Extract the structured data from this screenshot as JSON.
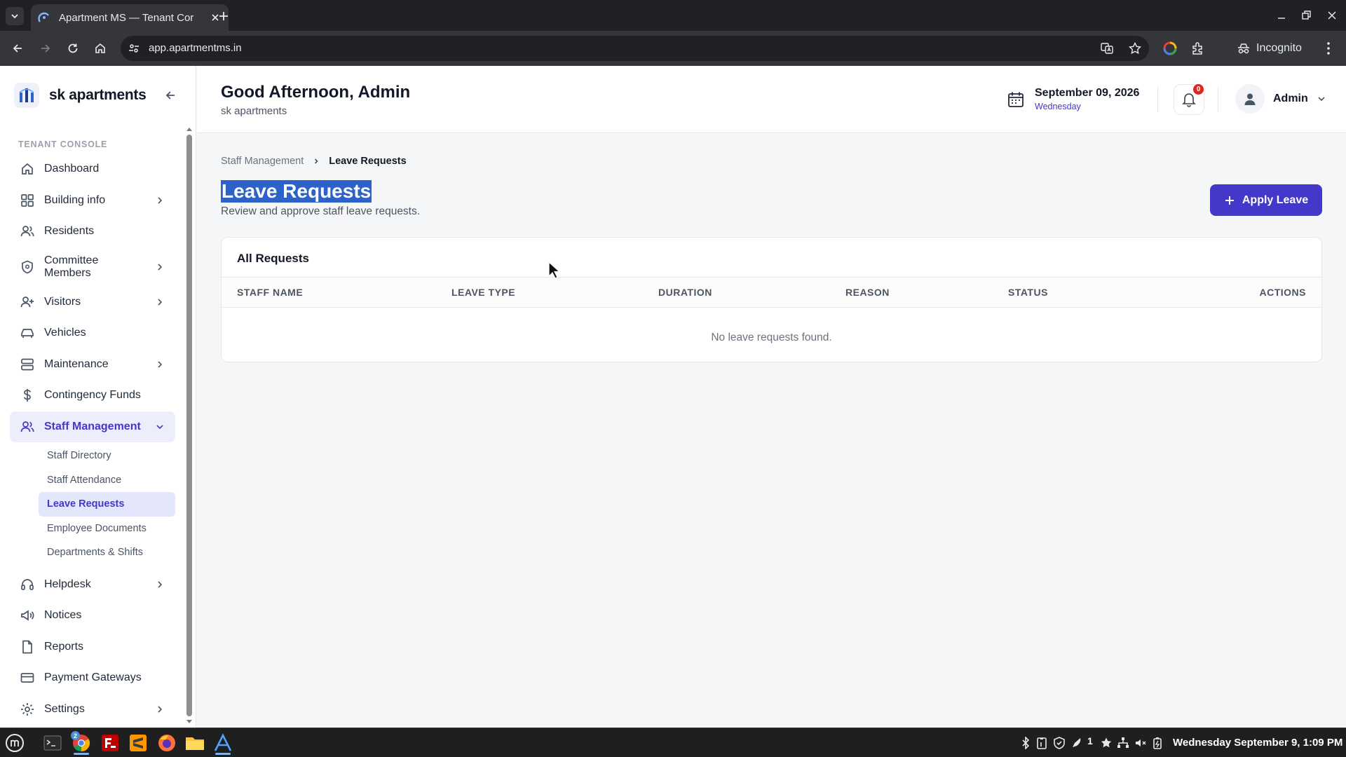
{
  "browser": {
    "tab_title": "Apartment MS — Tenant Cor",
    "url": "app.apartmentms.in",
    "profile_label": "Incognito"
  },
  "sidebar": {
    "brand_name": "sk apartments",
    "section_label": "TENANT CONSOLE",
    "items": [
      {
        "label": "Dashboard"
      },
      {
        "label": "Building info"
      },
      {
        "label": "Residents"
      },
      {
        "label": "Committee Members"
      },
      {
        "label": "Visitors"
      },
      {
        "label": "Vehicles"
      },
      {
        "label": "Maintenance"
      },
      {
        "label": "Contingency Funds"
      },
      {
        "label": "Staff Management"
      },
      {
        "label": "Helpdesk"
      },
      {
        "label": "Notices"
      },
      {
        "label": "Reports"
      },
      {
        "label": "Payment Gateways"
      },
      {
        "label": "Settings"
      }
    ],
    "staff_sub_items": [
      {
        "label": "Staff Directory"
      },
      {
        "label": "Staff Attendance"
      },
      {
        "label": "Leave Requests"
      },
      {
        "label": "Employee Documents"
      },
      {
        "label": "Departments & Shifts"
      }
    ]
  },
  "header": {
    "greeting": "Good Afternoon, Admin",
    "subtitle": "sk apartments",
    "date": "September 09, 2026",
    "weekday": "Wednesday",
    "notification_count": "0",
    "user_name": "Admin"
  },
  "page": {
    "breadcrumb_parent": "Staff Management",
    "breadcrumb_current": "Leave Requests",
    "title": "Leave Requests",
    "description": "Review and approve staff leave requests.",
    "apply_button": "Apply Leave",
    "card_title": "All Requests",
    "columns": [
      "STAFF NAME",
      "LEAVE TYPE",
      "DURATION",
      "REASON",
      "STATUS",
      "ACTIONS"
    ],
    "empty_message": "No leave requests found."
  },
  "taskbar": {
    "chrome_badge": "2",
    "tray_count": "1",
    "clock": "Wednesday September 9, 1:09 PM"
  },
  "colors": {
    "accent": "#4338ca",
    "selection": "#2d63c8",
    "badge": "#dc2626"
  }
}
